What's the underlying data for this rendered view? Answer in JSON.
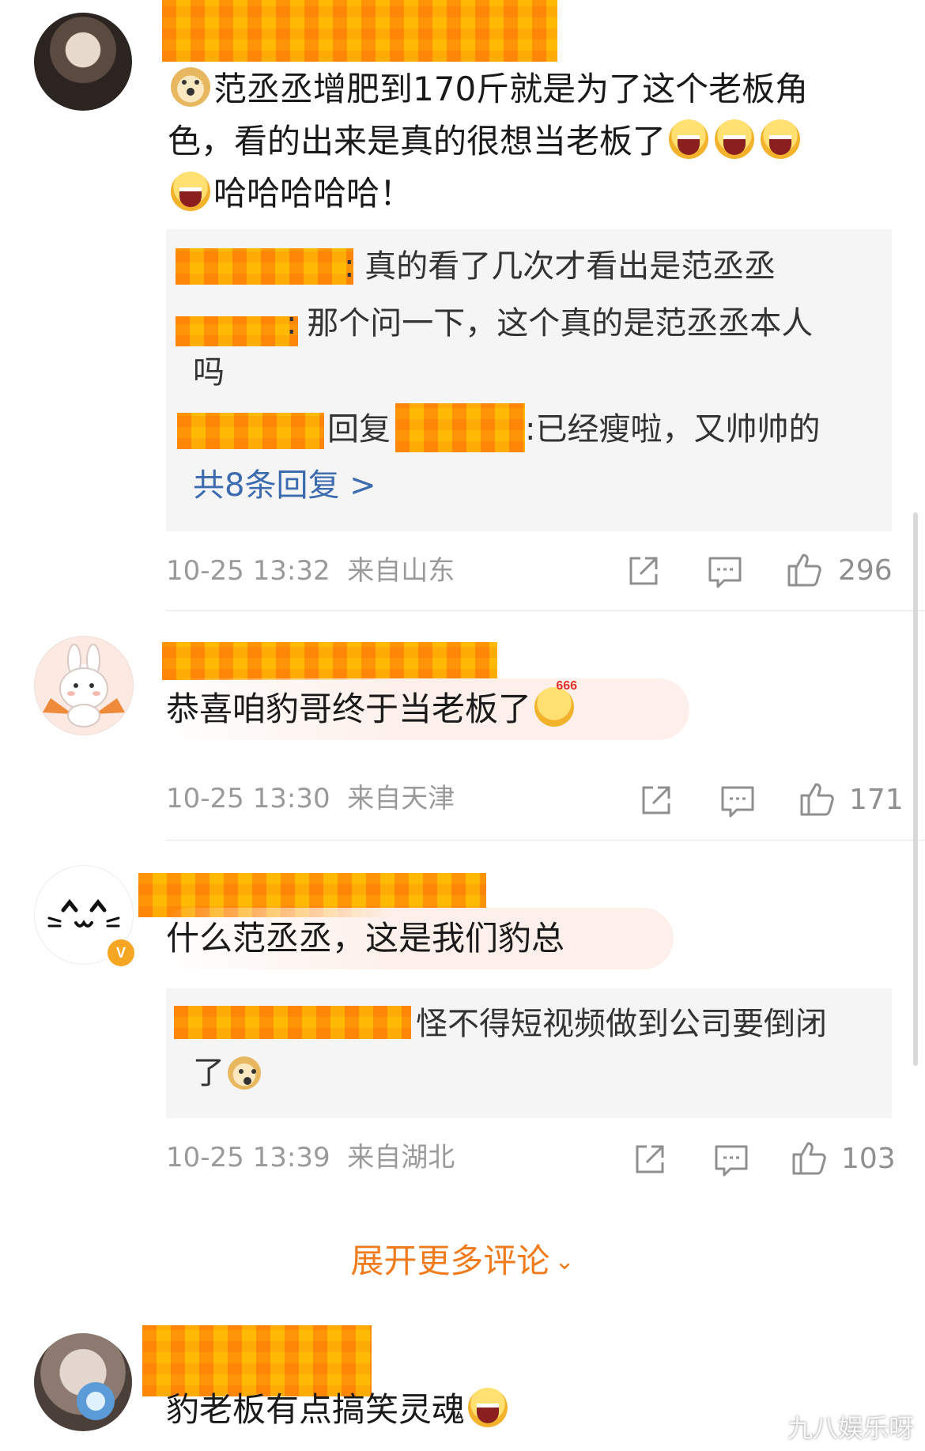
{
  "comments": [
    {
      "text_line1": "范丞丞增肥到170斤就是为了这个老板角",
      "text_line2": "色，看的出来是真的很想当老板了",
      "text_line3": "哈哈哈哈哈！",
      "replies": [
        {
          "sep": ":",
          "text": "真的看了几次才看出是范丞丞"
        },
        {
          "sep": ":",
          "text": "那个问一下，这个真的是范丞丞本人",
          "text_cont": "吗"
        },
        {
          "reply_word": "回复",
          "sep": ":",
          "text": "已经瘦啦，又帅帅的"
        }
      ],
      "more_replies": "共8条回复 >",
      "time": "10-25 13:32",
      "location": "来自山东",
      "likes": "296"
    },
    {
      "text": "恭喜咱豹哥终于当老板了",
      "time": "10-25 13:30",
      "location": "来自天津",
      "likes": "171"
    },
    {
      "text": "什么范丞丞，这是我们豹总",
      "reply_text_line1": "怪不得短视频做到公司要倒闭",
      "reply_text_line2": "了",
      "verified_mark": "V",
      "time": "10-25 13:39",
      "location": "来自湖北",
      "likes": "103"
    },
    {
      "text": "豹老板有点搞笑灵魂"
    }
  ],
  "expand_more": "展开更多评论",
  "expand_chevron": "⌄",
  "watermark": "九八娱乐呀",
  "icons": {
    "share": "share-icon",
    "comment": "comment-icon",
    "like": "thumbs-up-icon"
  },
  "colors": {
    "accent_orange": "#f07b1d",
    "link_blue": "#3c6bb0",
    "meta_gray": "#9a9a9a"
  }
}
